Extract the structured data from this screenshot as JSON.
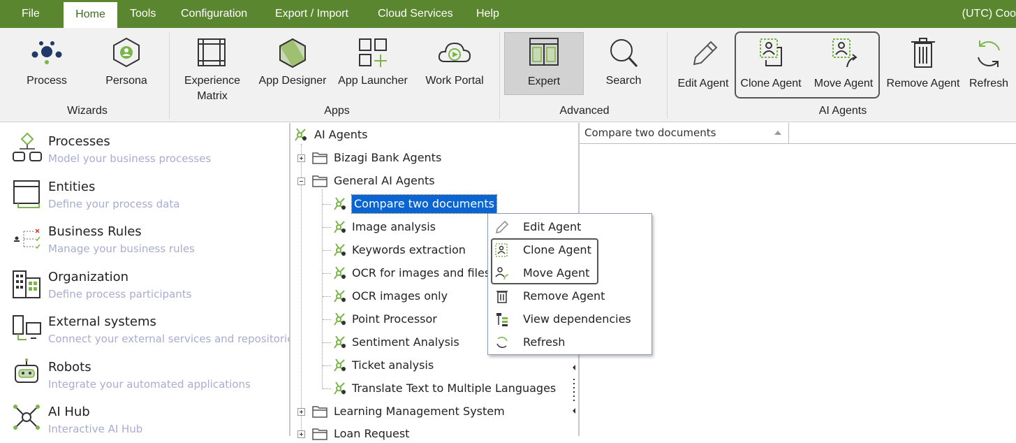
{
  "menubar": {
    "items": [
      "File",
      "Home",
      "Tools",
      "Configuration",
      "Export / Import",
      "Cloud Services",
      "Help"
    ],
    "clock": "(UTC) Coo"
  },
  "ribbon": {
    "wizards": {
      "label": "Wizards",
      "process": "Process",
      "persona": "Persona"
    },
    "apps": {
      "label": "Apps",
      "experience_line1": "Experience",
      "experience_line2": "Matrix",
      "app_designer": "App Designer",
      "app_launcher": "App Launcher",
      "work_portal": "Work Portal"
    },
    "advanced": {
      "label": "Advanced",
      "expert": "Expert",
      "search": "Search"
    },
    "ai_agents": {
      "label": "AI Agents",
      "edit": "Edit Agent",
      "clone": "Clone Agent",
      "move": "Move Agent",
      "remove": "Remove Agent",
      "refresh": "Refresh"
    }
  },
  "left_panel": {
    "items": [
      {
        "title": "Processes",
        "desc": "Model your business processes"
      },
      {
        "title": "Entities",
        "desc": "Define your process data"
      },
      {
        "title": "Business Rules",
        "desc": "Manage your business rules"
      },
      {
        "title": "Organization",
        "desc": "Define process participants"
      },
      {
        "title": "External systems",
        "desc": "Connect your external services and repositories"
      },
      {
        "title": "Robots",
        "desc": "Integrate your automated applications"
      },
      {
        "title": "AI Hub",
        "desc": "Interactive AI Hub"
      }
    ]
  },
  "tree": {
    "root": "AI Agents",
    "folders": [
      "Bizagi Bank Agents",
      "General AI Agents",
      "Learning Management System",
      "Loan Request"
    ],
    "agents": [
      "Compare two documents",
      "Image analysis",
      "Keywords extraction",
      "OCR for images and files",
      "OCR images only",
      "Point Processor",
      "Sentiment Analysis",
      "Ticket analysis",
      "Translate Text to Multiple Languages"
    ]
  },
  "grid": {
    "column_header": "Compare two documents"
  },
  "context_menu": {
    "items": [
      "Edit Agent",
      "Clone Agent",
      "Move Agent",
      "Remove Agent",
      "View dependencies",
      "Refresh"
    ]
  },
  "colors": {
    "menubar": "#5a8630",
    "accent_green": "#7ab648",
    "selection": "#0a64d2",
    "desc_text": "#a8acd0"
  }
}
